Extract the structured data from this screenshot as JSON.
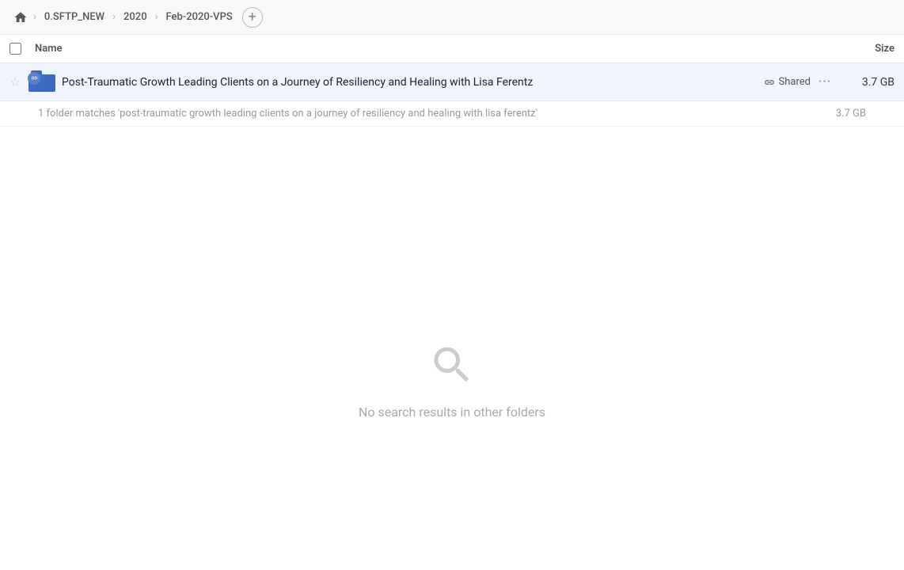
{
  "breadcrumb": {
    "home_icon": "home",
    "items": [
      {
        "label": "0.SFTP_NEW",
        "key": "sftp"
      },
      {
        "label": "2020",
        "key": "2020"
      },
      {
        "label": "Feb-2020-VPS",
        "key": "feb-2020-vps"
      }
    ],
    "add_label": "+"
  },
  "columns": {
    "name_label": "Name",
    "size_label": "Size"
  },
  "file_row": {
    "star": "☆",
    "name": "Post-Traumatic Growth Leading Clients on a Journey of Resiliency and Healing with Lisa Ferentz",
    "shared_label": "Shared",
    "more_label": "···",
    "size": "3.7 GB"
  },
  "match_info": {
    "text": "1 folder matches 'post-traumatic growth leading clients on a journey of resiliency and healing with lisa ferentz'",
    "size": "3.7 GB"
  },
  "empty_state": {
    "icon": "search",
    "text": "No search results in other folders"
  }
}
